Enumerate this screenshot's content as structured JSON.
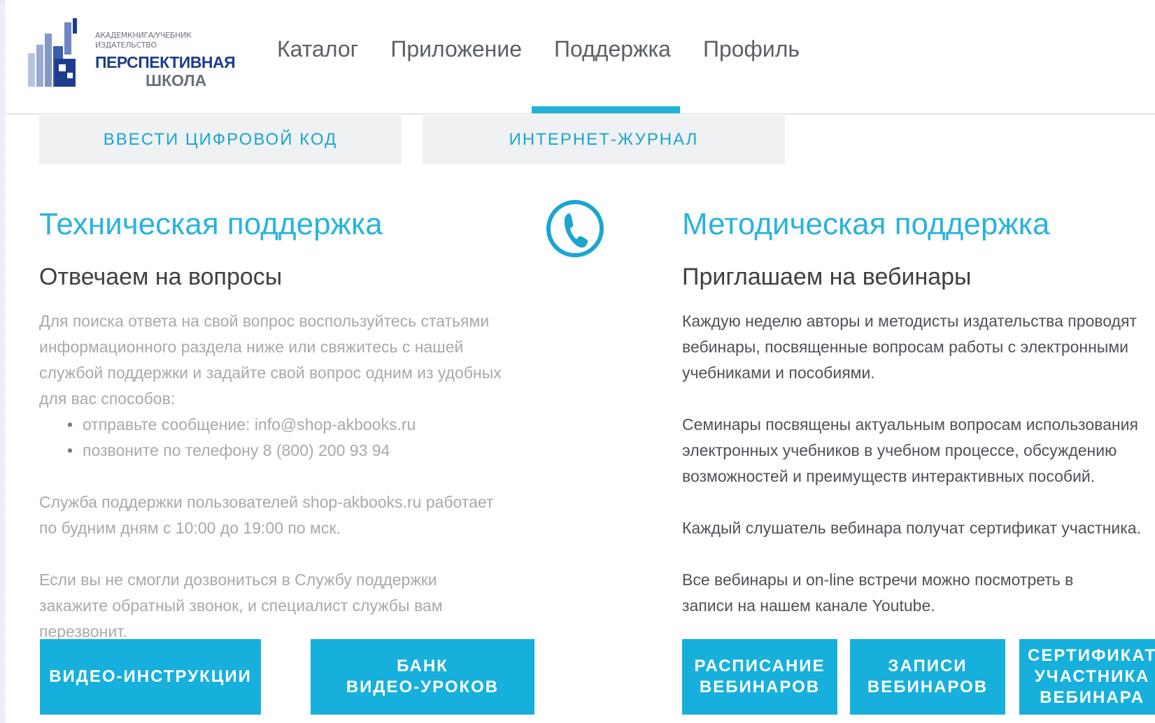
{
  "logo": {
    "publisher_line1": "Академкнига/Учебник",
    "publisher_line2": "Издательство",
    "name_line1": "ПЕРСПЕКТИВНАЯ",
    "name_line2": "ШКОЛА"
  },
  "nav": {
    "items": [
      {
        "label": "Каталог"
      },
      {
        "label": "Приложение"
      },
      {
        "label": "Поддержка",
        "active": true
      },
      {
        "label": "Профиль"
      }
    ]
  },
  "subtabs": [
    {
      "label": "ВВЕСТИ ЦИФРОВОЙ КОД"
    },
    {
      "label": "ИНТЕРНЕТ-ЖУРНАЛ"
    }
  ],
  "tech": {
    "title": "Техническая поддержка",
    "subtitle": "Отвечаем на вопросы",
    "intro": "Для поиска ответа на свой вопрос воспользуйтесь статьями информационного раздела ниже или свяжитесь с нашей службой поддержки и задайте свой вопрос одним из удобных для вас способов:",
    "bullets": [
      "отправьте сообщение: info@shop-akbooks.ru",
      "позвоните по телефону 8 (800) 200 93 94"
    ],
    "hours": "Служба поддержки пользователей shop-akbooks.ru работает по будним дням с 10:00 до 19:00 по мск.",
    "callback": "Если вы не смогли дозвониться в Службу поддержки закажите обратный звонок, и специалист службы вам перезвонит.",
    "buttons": [
      "ВИДЕО-ИНСТРУКЦИИ",
      "БАНК\nВИДЕО-УРОКОВ"
    ]
  },
  "method": {
    "title": "Методическая поддержка",
    "subtitle": "Приглашаем на вебинары",
    "p1": "Каждую неделю авторы и методисты издательства проводят вебинары, посвященные вопросам работы с электронными учебниками и пособиями.",
    "p2": "Семинары посвящены актуальным вопросам использования электронных учебников в учебном процессе, обсуждению возможностей и преимуществ интерактивных пособий.",
    "p3": "Каждый слушатель вебинара получат сертификат участника.",
    "p4": "Все вебинары и on-line встречи можно посмотреть в записи на нашем канале Youtube.",
    "buttons": [
      "РАСПИСАНИЕ\nВЕБИНАРОВ",
      "ЗАПИСИ\nВЕБИНАРОВ",
      "СЕРТИФИКАТ\nУЧАСТНИКА\nВЕБИНАРА"
    ]
  },
  "icons": {
    "phone": "phone-icon"
  },
  "colors": {
    "accent": "#17b0dc",
    "title": "#29b3dd",
    "brand": "#1c3d8f"
  }
}
